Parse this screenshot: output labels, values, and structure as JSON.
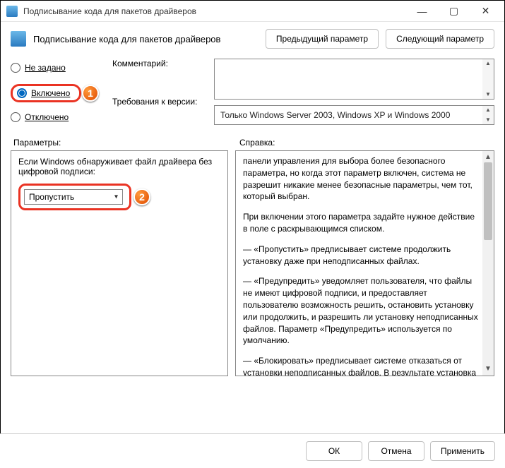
{
  "window": {
    "title": "Подписывание кода для пакетов драйверов",
    "minimize": "—",
    "maximize": "▢",
    "close": "✕"
  },
  "header": {
    "title": "Подписывание кода для пакетов драйверов",
    "prev": "Предыдущий параметр",
    "next": "Следующий параметр"
  },
  "state": {
    "not_configured": "Не задано",
    "enabled": "Включено",
    "disabled": "Отключено"
  },
  "fields": {
    "comment_label": "Комментарий:",
    "requirement_label": "Требования к версии:",
    "requirement_value": "Только Windows Server 2003, Windows XP и Windows 2000"
  },
  "sections": {
    "options": "Параметры:",
    "help": "Справка:"
  },
  "options": {
    "prompt": "Если Windows обнаруживает файл драйвера без цифровой подписи:",
    "dropdown_value": "Пропустить"
  },
  "help": {
    "p1": "панели управления для выбора более безопасного параметра, но когда этот параметр включен, система не разрешит никакие менее безопасные параметры, чем тот, который выбран.",
    "p2": "При включении этого параметра задайте нужное действие в поле с раскрывающимся списком.",
    "p3": "—   «Пропустить» предписывает системе продолжить установку даже при неподписанных файлах.",
    "p4": "—   «Предупредить» уведомляет пользователя, что файлы не имеют цифровой подписи, и предоставляет пользователю возможность решить, остановить установку или продолжить, и разрешить ли установку неподписанных файлов. Параметр «Предупредить» используется по умолчанию.",
    "p5": "—   «Блокировать» предписывает системе отказаться от установки неподписанных файлов. В результате установка прекращается и никакие файлы из пакета драйвера не устанавливаются"
  },
  "footer": {
    "ok": "ОК",
    "cancel": "Отмена",
    "apply": "Применить"
  },
  "markers": {
    "m1": "1",
    "m2": "2"
  }
}
